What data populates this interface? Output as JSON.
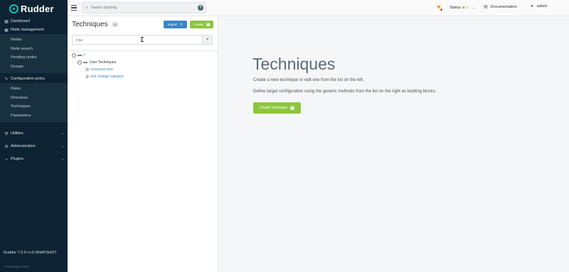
{
  "app": {
    "logo_text": "Rudder"
  },
  "sidebar": {
    "dashboard": "Dashboard",
    "node_management": "Node management",
    "node_items": [
      "Nodes",
      "Node search",
      "Pending nodes",
      "Groups"
    ],
    "configuration_policy": "Configuration policy",
    "config_items": [
      "Rules",
      "Directives",
      "Techniques",
      "Parameters"
    ],
    "utilities": "Utilities",
    "administration": "Administration",
    "plugins": "Plugins",
    "version": "Rudder 7.0.0~rc3-SNAPSHOT",
    "copyright": "© Normation 2021"
  },
  "topbar": {
    "search_placeholder": "Search anything",
    "help_glyph": "?",
    "status_label": "Status",
    "documentation_label": "Documentation",
    "user_label": "admin"
  },
  "left_panel": {
    "title": "Techniques",
    "badge": "0",
    "import_label": "Import",
    "create_label": "Create",
    "filter_placeholder": "Filter",
    "clear_glyph": "×",
    "tree": {
      "root_label": "/",
      "category_label": "User Techniques",
      "items": [
        "resources test",
        "test change category"
      ]
    }
  },
  "main": {
    "title": "Techniques",
    "line1": "Create a new technique or edit one from the list on the left.",
    "line2": "Define target configuration using the generic methods from the list on the right as building blocks.",
    "create_button": "Create Technique"
  },
  "icons": {
    "status_warning": "heart-warning-icon",
    "status_ok": "heart-check-icon",
    "accent_green": "#8dc63f",
    "accent_blue": "#3b86c3",
    "sidebar_bg": "#0d2333"
  }
}
